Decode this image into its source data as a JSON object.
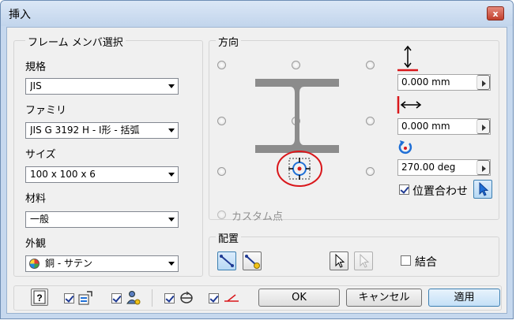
{
  "window": {
    "title": "挿入",
    "close_glyph": "x"
  },
  "frame_group": {
    "legend": "フレーム メンバ選択",
    "standard": {
      "label": "規格",
      "value": "JIS"
    },
    "family": {
      "label": "ファミリ",
      "value": "JIS G 3192 H - I形 - 括弧"
    },
    "size": {
      "label": "サイズ",
      "value": "100 x 100 x 6"
    },
    "material": {
      "label": "材料",
      "value": "一般"
    },
    "appearance": {
      "label": "外観",
      "value": "銅 - サテン"
    }
  },
  "orientation_group": {
    "legend": "方向",
    "custom_point_label": "カスタム点",
    "offset_vertical": {
      "value": "0.000 mm"
    },
    "offset_horizontal": {
      "value": "0.000 mm"
    },
    "rotation": {
      "value": "270.00 deg"
    },
    "align_label": "位置合わせ",
    "selected_point": "bottom-center"
  },
  "placement_group": {
    "legend": "配置",
    "merge_label": "結合"
  },
  "buttons": {
    "ok": "OK",
    "cancel": "キャンセル",
    "apply": "適用"
  },
  "colors": {
    "accent_red": "#d9171b",
    "highlight_blue": "#1f6fd6",
    "profile_gray": "#8c8c8c"
  }
}
